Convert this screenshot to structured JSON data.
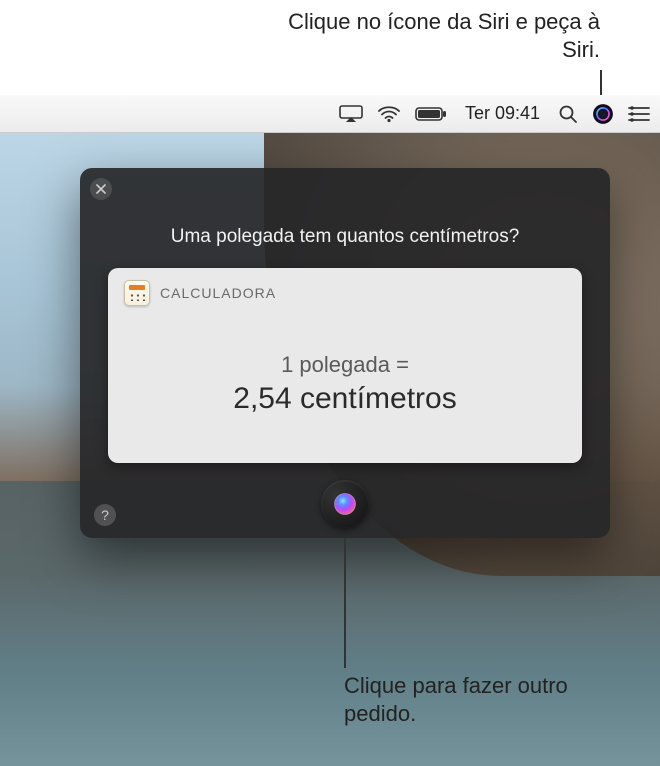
{
  "annotations": {
    "top": "Clique no ícone da Siri e peça à Siri.",
    "bottom": "Clique para fazer outro pedido."
  },
  "menubar": {
    "time": "Ter 09:41"
  },
  "siri": {
    "question": "Uma polegada tem quantos centímetros?",
    "card": {
      "app": "CALCULADORA",
      "line1": "1 polegada =",
      "line2": "2,54 centímetros"
    }
  }
}
